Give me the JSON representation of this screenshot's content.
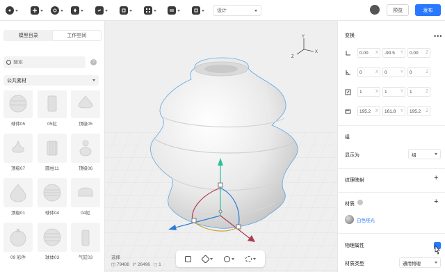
{
  "topbar": {
    "tools": [
      "cursor-tool",
      "add-tool",
      "shape-tool",
      "light-tool",
      "link-tool",
      "camera-tool",
      "grid-tool",
      "transform-tool"
    ],
    "mode_label": "设计",
    "preview_label": "预览",
    "publish_label": "发布",
    "accent": "#2979ff"
  },
  "left_panel": {
    "tabs": [
      "模型目录",
      "工作空间"
    ],
    "active_tab": 1,
    "search_placeholder": "搜索",
    "category": "公共素材",
    "items": [
      "球体05",
      "05缸",
      "顶级05",
      "顶级07",
      "圆柱11",
      "顶级06",
      "顶级01",
      "球体04",
      "04缸",
      "09 彩件",
      "球体03",
      "气缸03"
    ]
  },
  "viewport": {
    "stats_title": "选择",
    "vertices": "79488",
    "faces": "26496",
    "objects": "1",
    "axis_labels": [
      "Y",
      "X",
      "Z"
    ]
  },
  "right_panel": {
    "transform_title": "变换",
    "position": {
      "x": "0.00",
      "y": "-90.5",
      "z": "0.00"
    },
    "rotation": {
      "x": "0",
      "y": "0",
      "z": "0"
    },
    "scale": {
      "x": "1",
      "y": "1",
      "z": "1"
    },
    "size": {
      "x": "195.2",
      "y": "161.8",
      "z": "195.2"
    },
    "axis_x": "X",
    "axis_y": "Y",
    "axis_z": "Z",
    "group_title": "组",
    "display_label": "显示为",
    "display_value": "组",
    "texture_title": "纹理映射",
    "material_title": "材质",
    "material_name": "白色哑光",
    "physics_title": "物理属性",
    "physics_label": "材质类型",
    "physics_value": "通用物理"
  }
}
